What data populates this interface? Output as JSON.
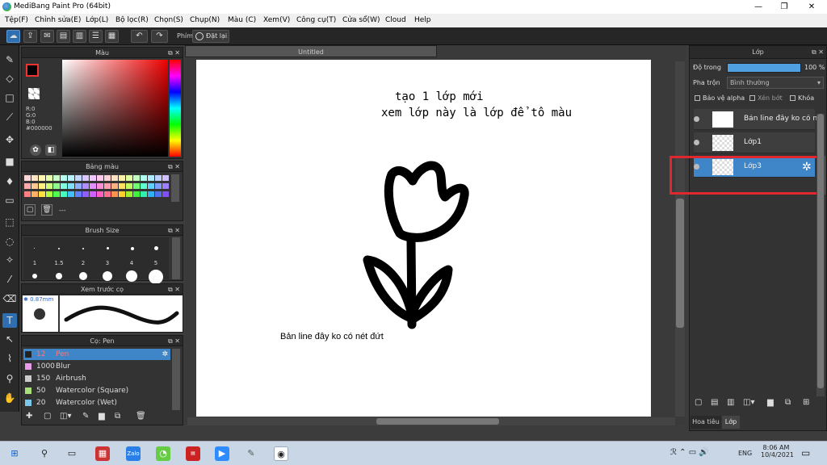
{
  "window": {
    "title": "MediBang Paint Pro (64bit)"
  },
  "menu": [
    "Tệp(F)",
    "Chỉnh sửa(E)",
    "Lớp(L)",
    "Bộ lọc(R)",
    "Chọn(S)",
    "Chụp(N)",
    "Màu (C)",
    "Xem(V)",
    "Công cụ(T)",
    "Cửa sổ(W)",
    "Cloud",
    "Help"
  ],
  "toolbar": {
    "phim_label": "Phím",
    "datlai_label": "Đặt lại"
  },
  "color_panel": {
    "title": "Màu",
    "r": "R:0",
    "g": "G:0",
    "b": "B:0",
    "hex": "#000000"
  },
  "palette_panel": {
    "title": "Bảng màu",
    "entry": "---"
  },
  "brushsize_panel": {
    "title": "Brush Size",
    "sizes": [
      "1",
      "1.5",
      "2",
      "3",
      "4",
      "5"
    ]
  },
  "preview_panel": {
    "title": "Xem trước cọ",
    "size": "0.87mm"
  },
  "brush_panel": {
    "title": "Cọ: Pen",
    "items": [
      {
        "size": "12",
        "name": "Pen",
        "color": "#222222"
      },
      {
        "size": "1000",
        "name": "Blur",
        "color": "#e79ce9"
      },
      {
        "size": "150",
        "name": "Airbrush",
        "color": "#cccccc"
      },
      {
        "size": "50",
        "name": "Watercolor (Square)",
        "color": "#a9e07a"
      },
      {
        "size": "20",
        "name": "Watercolor (Wet)",
        "color": "#7ac8e9"
      }
    ]
  },
  "document": {
    "tab_title": "Untitled",
    "text_line1": "tạo 1 lớp mới",
    "text_line2": "xem lớp này là lớp để tô màu",
    "text_line3": "Bản line đây ko có nét đứt"
  },
  "layer_panel": {
    "title": "Lớp",
    "opacity_label": "Độ trong",
    "opacity_value": "100 %",
    "opacity_fraction": 1.0,
    "blend_label": "Pha trộn",
    "blend_value": "Bình thường",
    "protect_alpha": "Bảo vệ alpha",
    "clipping": "Xén bớt",
    "lock": "Khóa",
    "layers": [
      {
        "name": "Bản line đây ko có nét đứt",
        "selected": false
      },
      {
        "name": "Lớp1",
        "selected": false
      },
      {
        "name": "Lớp3",
        "selected": true
      }
    ],
    "tab_left": "Hoa tiêu",
    "tab_right": "Lớp"
  },
  "taskbar": {
    "lang": "ENG",
    "time": "8:06 AM",
    "date": "10/4/2021"
  },
  "colors": {
    "accent": "#3f86c9",
    "highlight_box": "#e0262f"
  }
}
